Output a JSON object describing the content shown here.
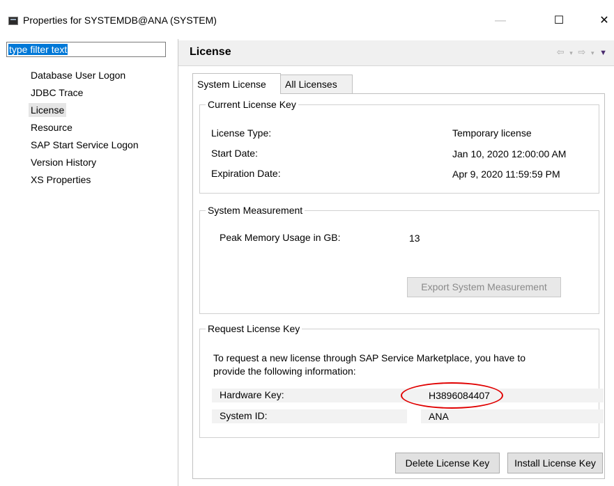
{
  "window": {
    "title": "Properties for SYSTEMDB@ANA (SYSTEM)",
    "min_glyph": "—",
    "max_glyph": "☐",
    "close_glyph": "✕"
  },
  "sidebar": {
    "filter": {
      "value": "type filter text"
    },
    "items": [
      {
        "label": "Database User Logon"
      },
      {
        "label": "JDBC Trace"
      },
      {
        "label": "License",
        "selected": true
      },
      {
        "label": "Resource"
      },
      {
        "label": "SAP Start Service Logon"
      },
      {
        "label": "Version History"
      },
      {
        "label": "XS Properties"
      }
    ]
  },
  "page": {
    "title": "License",
    "nav": {
      "back_icon": "⇦",
      "forward_icon": "⇨",
      "dropdown": "▾",
      "menu": "▼"
    }
  },
  "tabs": [
    {
      "label": "System License",
      "active": true
    },
    {
      "label": "All Licenses",
      "active": false
    }
  ],
  "current_license": {
    "title": "Current License Key",
    "rows": [
      {
        "label": "License Type:",
        "value": "Temporary license"
      },
      {
        "label": "Start Date:",
        "value": "Jan 10, 2020 12:00:00 AM"
      },
      {
        "label": "Expiration Date:",
        "value": "Apr 9, 2020 11:59:59 PM"
      }
    ]
  },
  "measurement": {
    "title": "System Measurement",
    "label": "Peak Memory Usage in GB:",
    "value": "13",
    "export_button": "Export System Measurement"
  },
  "request": {
    "title": "Request License Key",
    "text_line1": "To request a new license through SAP Service Marketplace, you have to",
    "text_line2": "provide the following information:",
    "hardware_key_label": "Hardware Key:",
    "hardware_key_value": "H3896084407",
    "system_id_label": "System ID:",
    "system_id_value": "ANA"
  },
  "buttons": {
    "delete": "Delete License Key",
    "install": "Install License Key"
  },
  "colors": {
    "highlight": "#e00000",
    "selection": "#0078d7"
  }
}
